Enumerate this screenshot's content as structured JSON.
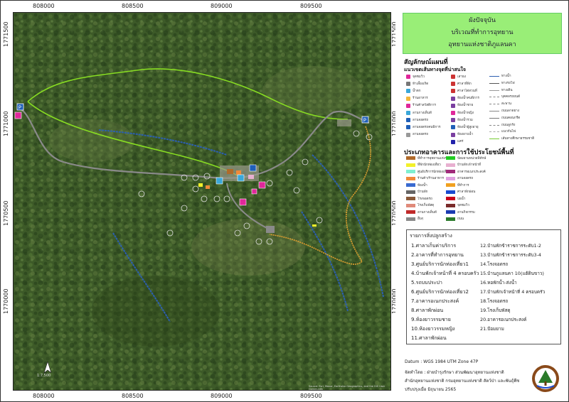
{
  "title": {
    "line1": "ผังปัจจุบัน",
    "line2": "บริเวณที่ทำการอุทยาน",
    "line3": "อุทยานแห่งชาติภูแลนคา"
  },
  "axes": {
    "top_x": [
      "808000",
      "808500",
      "809000",
      "809500"
    ],
    "bottom_x": [
      "808000",
      "808500",
      "809000",
      "809500"
    ],
    "left_y": [
      "1771500",
      "1771000",
      "1770500",
      "1770000"
    ],
    "right_y": [
      "1771500",
      "1771000",
      "1770500",
      "1770000"
    ]
  },
  "legend": {
    "heading": "สัญลักษณ์แผนที่",
    "poi_heading": "แนวเขตเส้นทางจุดที่น่าสนใจ",
    "symbols_col1": [
      {
        "label": "จุดชมวิว",
        "icon": "viewpoint-icon",
        "color": "#e0279a"
      },
      {
        "label": "ห้าเลี้ยงเกิด",
        "icon": "flag-icon",
        "color": "#777777"
      },
      {
        "label": "น้ำตก",
        "icon": "waterfall-icon",
        "color": "#3aa7d9"
      },
      {
        "label": "ร้านอาหาร",
        "icon": "restaurant-icon",
        "color": "#f3b63a"
      },
      {
        "label": "ร้านค้าสวัสดิการ",
        "icon": "shop-icon",
        "color": "#e0279a"
      },
      {
        "label": "ลานกางเต็นท์",
        "icon": "tent-icon",
        "color": "#3aa7d9"
      },
      {
        "label": "ลานจอดรถ",
        "icon": "parking-icon",
        "color": "#1f5fb8"
      },
      {
        "label": "ลานจอดรถคนพิการ",
        "icon": "accessible-parking-icon",
        "color": "#1f5fb8"
      },
      {
        "label": "ลานจอดรถ",
        "icon": "car-park-icon",
        "color": "#999999"
      }
    ],
    "symbols_col2": [
      {
        "label": "เสาธง",
        "icon": "flagpole-icon",
        "color": "#c33"
      },
      {
        "label": "ศาลาที่พัก",
        "icon": "pavilion-icon",
        "color": "#c33"
      },
      {
        "label": "ศาลาไต่สวนที่",
        "icon": "pavilion2-icon",
        "color": "#c33"
      },
      {
        "label": "ห้องน้ำคนพิการ",
        "icon": "accessible-toilet-icon",
        "color": "#7a3fa0"
      },
      {
        "label": "ห้องน้ำชาย",
        "icon": "male-toilet-icon",
        "color": "#7a3fa0"
      },
      {
        "label": "ห้องน้ำหญิง",
        "icon": "female-toilet-icon",
        "color": "#e0279a"
      },
      {
        "label": "ห้องน้ำรวม",
        "icon": "toilet-icon",
        "color": "#7a3fa0"
      },
      {
        "label": "ห้องน้ำผู้สูงอายุ",
        "icon": "elder-toilet-icon",
        "color": "#1f5fb8"
      },
      {
        "label": "ห้องอาบน้ำ",
        "icon": "shower-icon",
        "color": "#7a3fa0"
      },
      {
        "label": "แคร่",
        "icon": "bench-icon",
        "color": "#22a"
      }
    ],
    "lines": [
      {
        "label": "ทางน้ำ",
        "style": "stream",
        "color": "#2c5fb0"
      },
      {
        "label": "ทางรถไฟ",
        "style": "rail",
        "color": "#555555"
      },
      {
        "label": "ทางเดิน",
        "style": "walk",
        "color": "#999999"
      },
      {
        "label": "บุคคลรถยนต์",
        "style": "dash",
        "color": "#888888"
      },
      {
        "label": "สะพาน",
        "style": "dash",
        "color": "#888888"
      },
      {
        "label": "ถนนลาดยาง",
        "style": "road",
        "color": "#888888"
      },
      {
        "label": "ถนนคอนกรีต",
        "style": "road",
        "color": "#777777"
      },
      {
        "label": "ถนนลูกรัง",
        "style": "dash",
        "color": "#888888"
      },
      {
        "label": "แนวกันไฟ",
        "style": "dash",
        "color": "#aaaaaa"
      },
      {
        "label": "เส้นทางศึกษาธรรมชาติ",
        "style": "trail",
        "color": "#77cc33"
      }
    ],
    "landuse_heading": "ประเภทอาคารและการใช้ประโยชน์พื้นที่",
    "landuse_col1": [
      {
        "label": "ที่ทำการอุทยานแห่งชาติ",
        "color": "#b06a2a"
      },
      {
        "label": "ที่พักนักท่องเที่ยว",
        "color": "#f2f02a"
      },
      {
        "label": "ศูนย์บริการนักท่องเที่ยว",
        "color": "#7ff0d0"
      },
      {
        "label": "ร้านค้า/ร้านอาหาร",
        "color": "#f08a3a"
      },
      {
        "label": "ห้องน้ำ",
        "color": "#3a6ad0"
      },
      {
        "label": "บ้านพัก",
        "color": "#666666"
      },
      {
        "label": "โรงจอดรถ",
        "color": "#8a5a3a"
      },
      {
        "label": "โรงเก็บพัสดุ",
        "color": "#e08a7a"
      },
      {
        "label": "ลานกางเต็นท์",
        "color": "#c02a2a"
      },
      {
        "label": "อื่นๆ",
        "color": "#888888"
      }
    ],
    "landuse_col2": [
      {
        "label": "ป้อมยามหน่วยพิทักษ์",
        "color": "#22cc22"
      },
      {
        "label": "บ้านพักเจ้าหน้าที่",
        "color": "#e8b0d0"
      },
      {
        "label": "อาคารอเนกประสงค์",
        "color": "#a02a7a"
      },
      {
        "label": "ลานจอดรถ",
        "color": "#e0a0e0"
      },
      {
        "label": "ที่ทำการ",
        "color": "#f0a020"
      },
      {
        "label": "ศาลาพักผ่อน",
        "color": "#1a4ad0"
      },
      {
        "label": "บ่อน้ำ",
        "color": "#c8001a"
      },
      {
        "label": "จุดชมวิว",
        "color": "#7a2a2a"
      },
      {
        "label": "ลานกิจกรรม",
        "color": "#1a3ab0"
      },
      {
        "label": "ถนน",
        "color": "#2a7a2a"
      }
    ]
  },
  "buildings": {
    "heading": "รายการสิ่งปลูกสร้าง",
    "col1": [
      "1.ศาลาเก็บค่าบริการ",
      "2.อาคารที่ทำการอุทยาน",
      "3.ศูนย์บริการนักท่องเที่ยว1",
      "4.บ้านพักเจ้าหน้าที่ 4 ครอบครัว",
      "5.รถบบประปา",
      "6.ศูนย์บริการนักท่องเที่ยว2",
      "7.อาคารอเนกประสงค์",
      "8.ศาลาพักผ่อน",
      "9.ห้องยาวรรมชาย",
      "10.ห้องยาวรรมหญิง",
      "11.ศาลาพักผ่อน"
    ],
    "col2": [
      "12.บ้านพักข้าราชการระดับ1-2",
      "13.บ้านพักข้าราชการระดับ3-4",
      "14.โรงจอดรถ",
      "15.บ้านภูแลนคา 10(แฮ้ดินขาว)",
      "16.หอพักน้ำ-ส่งน้ำ",
      "17.บ้านพักเจ้าหน้าที่ 4 ครอบครัว",
      "18.โรงจอดรถ",
      "19.โรงเก็บพัสดุ",
      "20.อาคารอเนกประสงค์",
      "21.ป้อมยาม"
    ]
  },
  "footer": {
    "datum": "Datum : WGS 1984 UTM Zone 47P",
    "made_by": "จัดทำโดย : ฝ่ายบำรุงรักษา ส่วนพัฒนาอุทยานแห่งชาติ",
    "agency": "สำนักอุทยานแห่งชาติ กรมอุทยานแห่งชาติ สัตว์ป่า และพันธุ์พืช",
    "updated": "ปรับปรุงเมื่อ มิถุนายน 2565"
  },
  "map": {
    "attribution": "Source: Esri, Maxar, Earthstar Geographics, and the GIS User Community",
    "scale_label": "1:7,500"
  },
  "colors": {
    "trail": "#88dd22",
    "road": "#8a8a8a",
    "stream": "#2c5fb0",
    "dirt_road": "#e0a030",
    "title_bg": "#99ee77"
  }
}
